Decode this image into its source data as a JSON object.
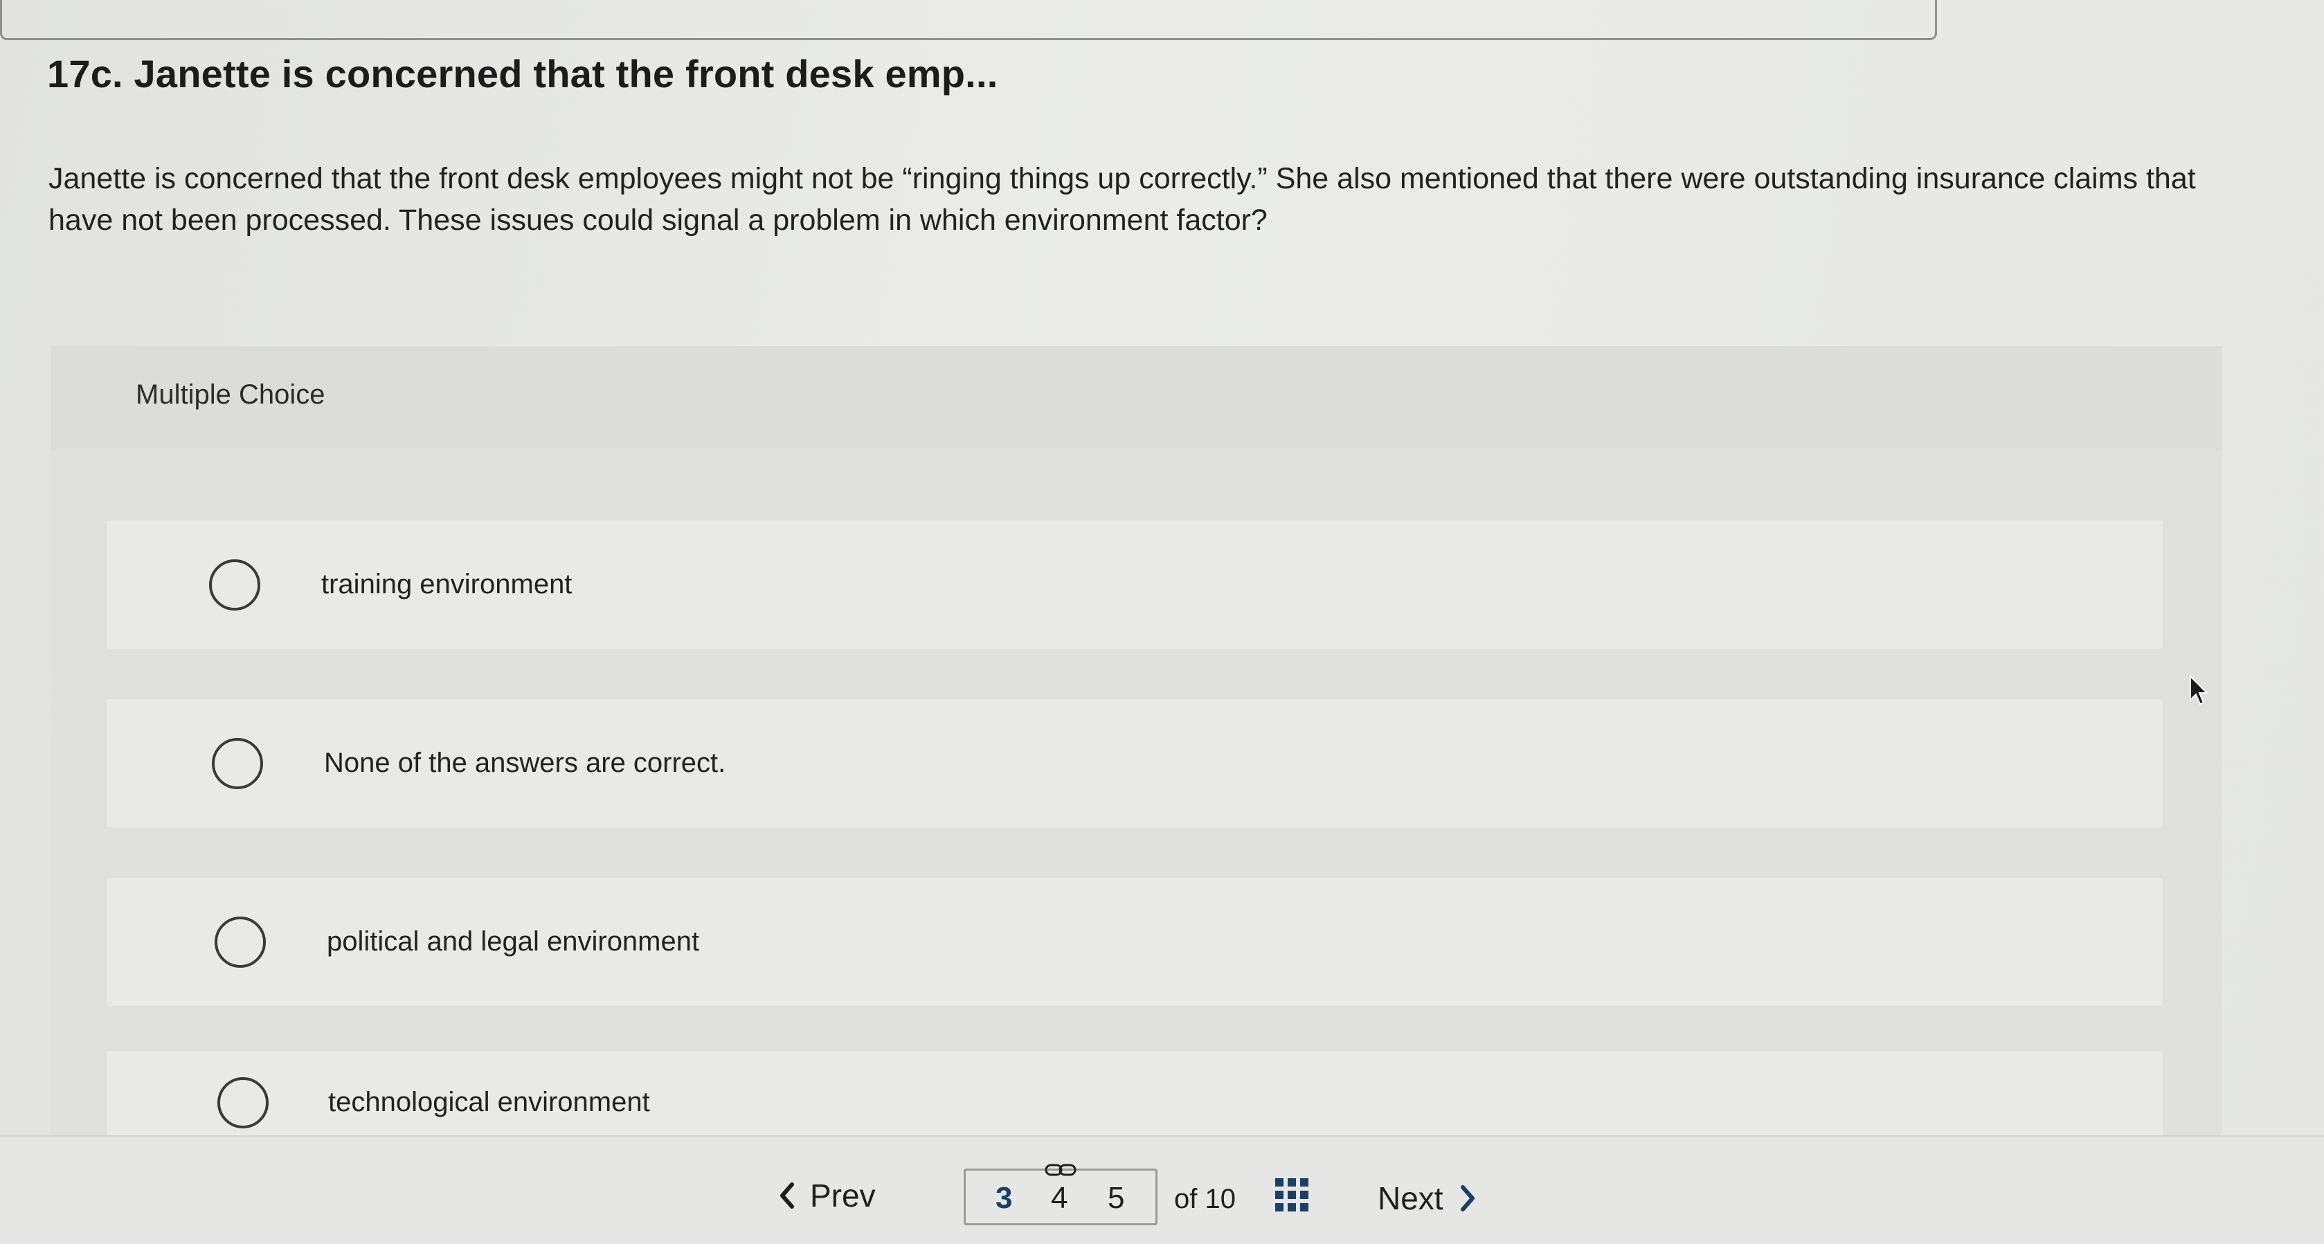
{
  "question": {
    "title": "17c. Janette is concerned that the front desk emp...",
    "body": "Janette is concerned that the front desk employees might not be “ringing things up correctly.” She also mentioned that there were outstanding insurance claims that have not been processed. These issues could signal a problem in which environment factor?"
  },
  "multiple_choice": {
    "label": "Multiple Choice",
    "options": [
      {
        "label": "training environment",
        "selected": false
      },
      {
        "label": "None of the answers are correct.",
        "selected": false
      },
      {
        "label": "political and legal environment",
        "selected": false
      },
      {
        "label": "technological environment",
        "selected": false
      }
    ]
  },
  "footer": {
    "prev_label": "Prev",
    "next_label": "Next",
    "pages": [
      "3",
      "4",
      "5"
    ],
    "current_page": "3",
    "of_total": "of 10",
    "icons": {
      "prev": "chevron-left-icon",
      "next": "chevron-right-icon",
      "link": "link-icon",
      "grid": "grid-icon"
    }
  },
  "colors": {
    "accent": "#1a3f66",
    "background": "#e8e9e6"
  }
}
